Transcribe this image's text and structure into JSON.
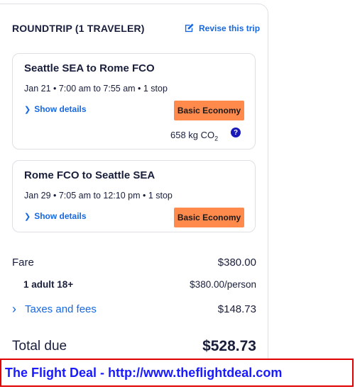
{
  "header": {
    "title": "ROUNDTRIP (1 TRAVELER)",
    "revise_label": "Revise this trip"
  },
  "flights": [
    {
      "route": "Seattle SEA to Rome FCO",
      "times": "Jan 21 • 7:00 am to 7:55 am • 1 stop",
      "details_label": "Show details",
      "cabin": "Basic Economy",
      "co2": "658 kg CO",
      "co2_sub": "2"
    },
    {
      "route": "Rome FCO to Seattle SEA",
      "times": "Jan 29 • 7:05 am to 12:10 pm • 1 stop",
      "details_label": "Show details",
      "cabin": "Basic Economy"
    }
  ],
  "summary": {
    "fare_label": "Fare",
    "fare_value": "$380.00",
    "adult_label": "1 adult 18+",
    "adult_value": "$380.00/person",
    "taxes_label": "Taxes and fees",
    "taxes_value": "$148.73",
    "total_label": "Total due",
    "total_value": "$528.73"
  },
  "banner": {
    "text": "The Flight Deal - http://www.theflightdeal.com"
  },
  "icons": {
    "revise": "edit-icon",
    "details": "chevron-right-icon",
    "info": "question-icon"
  },
  "colors": {
    "link": "#1668e3",
    "badge": "#ff8a4c",
    "banner_border": "#e00000",
    "banner_text": "#1a1aff"
  }
}
